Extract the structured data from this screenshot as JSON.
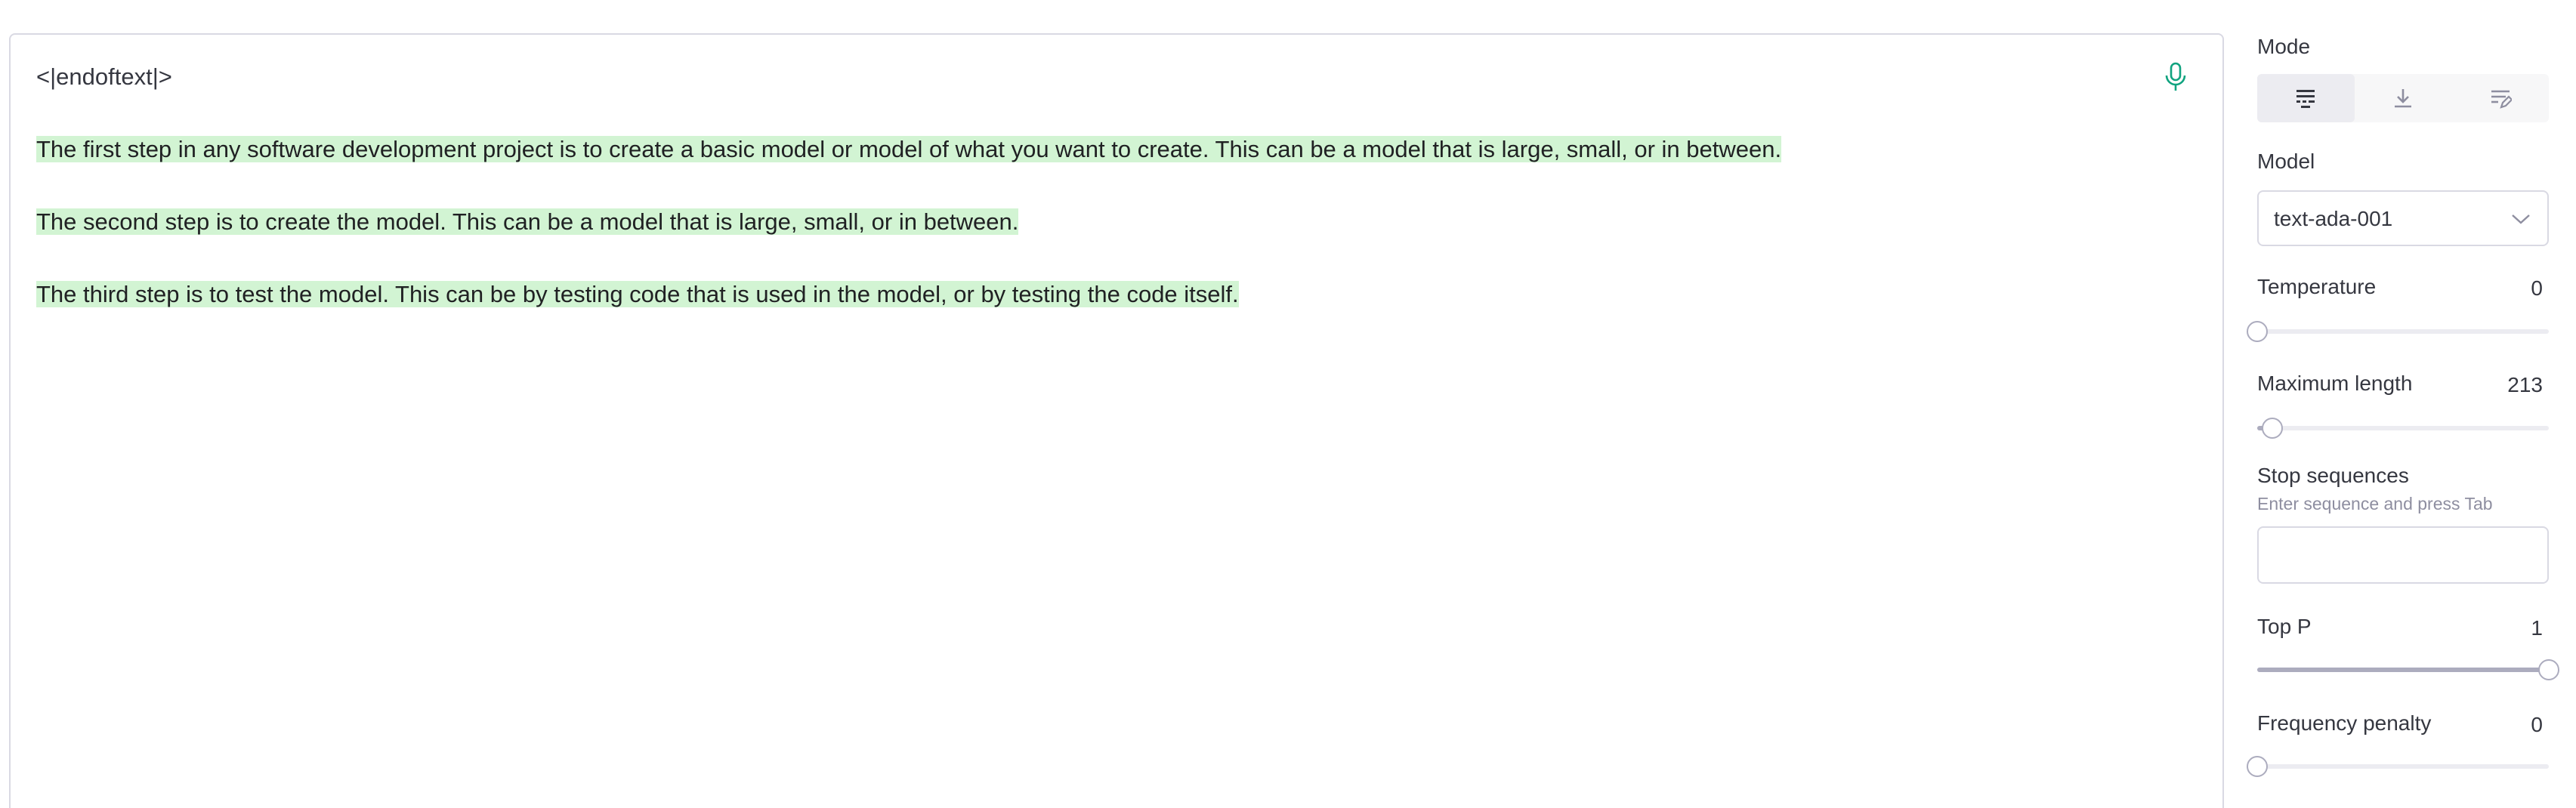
{
  "editor": {
    "lines": [
      "<|endoftext|>",
      "The first step in any software development project is to create a basic model or model of what you want to create. This can be a model that is large, small, or in between.",
      "The second step is to create the model. This can be a model that is large, small, or in between.",
      "The third step is to test the model. This can be by testing code that is used in the model, or by testing the code itself."
    ],
    "mic_icon": "microphone-icon",
    "highlight_color": "#d2f4d3",
    "mic_color": "#10a37f"
  },
  "settings": {
    "mode": {
      "label": "Mode",
      "options": [
        {
          "icon": "complete-mode-icon",
          "selected": true
        },
        {
          "icon": "insert-mode-icon",
          "selected": false
        },
        {
          "icon": "edit-mode-icon",
          "selected": false
        }
      ]
    },
    "model": {
      "label": "Model",
      "value": "text-ada-001"
    },
    "temperature": {
      "label": "Temperature",
      "value": "0",
      "min": 0,
      "max": 1,
      "current": 0
    },
    "max_length": {
      "label": "Maximum length",
      "value": "213",
      "min": 1,
      "max": 4000,
      "current": 213
    },
    "stop_sequences": {
      "label": "Stop sequences",
      "hint": "Enter sequence and press Tab",
      "value": ""
    },
    "top_p": {
      "label": "Top P",
      "value": "1",
      "min": 0,
      "max": 1,
      "current": 1
    },
    "frequency_penalty": {
      "label": "Frequency penalty",
      "value": "0",
      "min": 0,
      "max": 2,
      "current": 0
    }
  }
}
